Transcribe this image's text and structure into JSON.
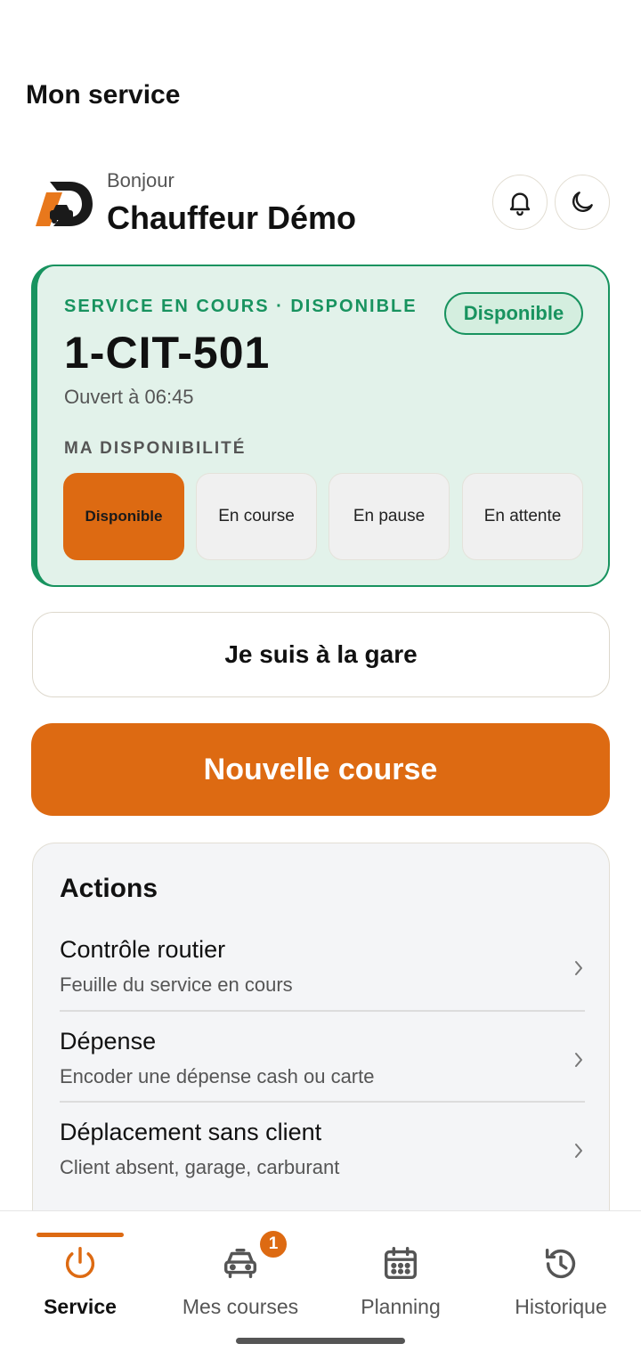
{
  "page": {
    "title": "Mon service"
  },
  "header": {
    "greeting": "Bonjour",
    "driver_name": "Chauffeur Démo",
    "logo_icon": "taxi-logo-icon",
    "notifications_icon": "bell-icon",
    "theme_icon": "moon-icon"
  },
  "service": {
    "status_line": "SERVICE EN COURS · DISPONIBLE",
    "status_badge": "Disponible",
    "vehicle_plate": "1-CIT-501",
    "opened_at": "Ouvert à 06:45",
    "availability_title": "MA DISPONIBILITÉ",
    "availability_options": [
      {
        "label": "Disponible",
        "selected": true
      },
      {
        "label": "En course",
        "selected": false
      },
      {
        "label": "En pause",
        "selected": false
      },
      {
        "label": "En attente",
        "selected": false
      }
    ]
  },
  "buttons": {
    "at_station": "Je suis à la gare",
    "new_ride": "Nouvelle course"
  },
  "actions": {
    "title": "Actions",
    "items": [
      {
        "title": "Contrôle routier",
        "subtitle": "Feuille du service en cours"
      },
      {
        "title": "Dépense",
        "subtitle": "Encoder une dépense cash ou carte"
      },
      {
        "title": "Déplacement sans client",
        "subtitle": "Client absent, garage, carburant"
      }
    ]
  },
  "nav": {
    "tabs": [
      {
        "label": "Service",
        "icon": "power-icon",
        "active": true
      },
      {
        "label": "Mes courses",
        "icon": "car-icon",
        "active": false,
        "badge": "1"
      },
      {
        "label": "Planning",
        "icon": "calendar-icon",
        "active": false
      },
      {
        "label": "Historique",
        "icon": "history-icon",
        "active": false
      }
    ]
  },
  "colors": {
    "accent": "#dd6a12",
    "success": "#18935f",
    "service_card_bg": "#e2f2ea"
  }
}
